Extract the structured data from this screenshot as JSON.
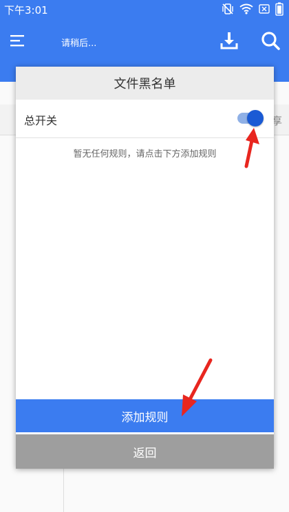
{
  "status_bar": {
    "time": "下午3:01",
    "icons": [
      "vibrate-off-icon",
      "wifi-icon",
      "sim-icon",
      "battery-icon"
    ]
  },
  "app_bar": {
    "title": "请稍后...",
    "icons": [
      "menu-icon",
      "download-icon",
      "search-icon"
    ]
  },
  "background": {
    "share_label": "享"
  },
  "dialog": {
    "title": "文件黑名单",
    "master_switch": {
      "label": "总开关",
      "on": true
    },
    "empty_hint": "暂无任何规则，请点击下方添加规则",
    "add_button": "添加规则",
    "back_button": "返回"
  },
  "colors": {
    "primary": "#3b7cf0",
    "toggle_thumb": "#1a5ad4",
    "toggle_track": "#8fb0e6",
    "back_button": "#9e9e9e",
    "annotation_arrow": "#e8261f"
  }
}
